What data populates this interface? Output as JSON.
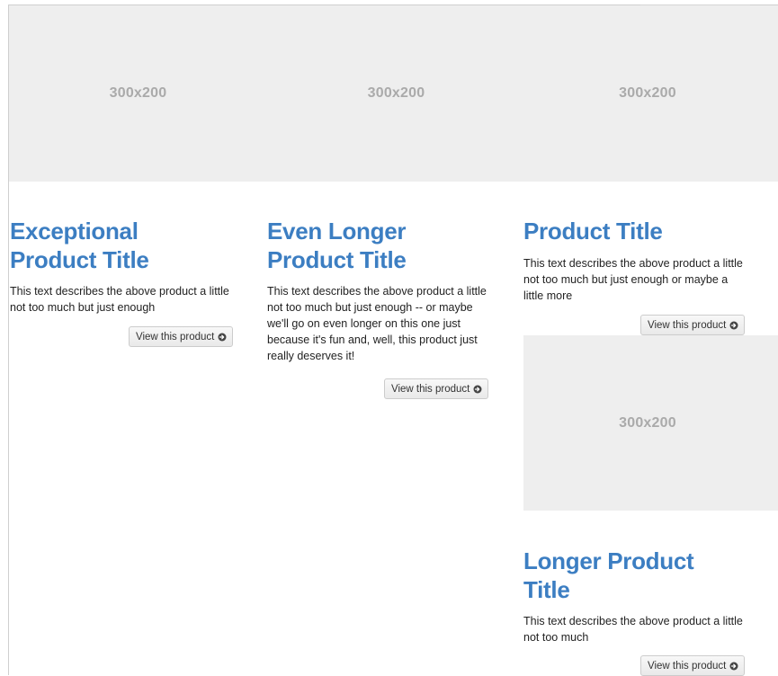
{
  "products": [
    {
      "image_label": "300x200",
      "title": "Exceptional Product Title",
      "description": "This text describes the above product a little not too much but just enough",
      "button_label": "View this product"
    },
    {
      "image_label": "300x200",
      "title": "Even Longer Product Title",
      "description": "This text describes the above product a little not too much but just enough -- or maybe we'll go on even longer on this one just because it's fun and, well, this product just really deserves it!",
      "button_label": "View this product"
    },
    {
      "image_label": "300x200",
      "title": "Product Title",
      "description": "This text describes the above product a little not too much but just enough or maybe a little more",
      "button_label": "View this product"
    },
    {
      "image_label": "300x200",
      "title": "Longer Product Title",
      "description": "This text describes the above product a little not too much",
      "button_label": "View this product"
    }
  ],
  "icons": {
    "button_icon": "circle-arrow-right-icon"
  },
  "colors": {
    "title": "#3c7ec2",
    "placeholder_bg": "#eeeeee",
    "placeholder_text": "#aaaaaa"
  }
}
